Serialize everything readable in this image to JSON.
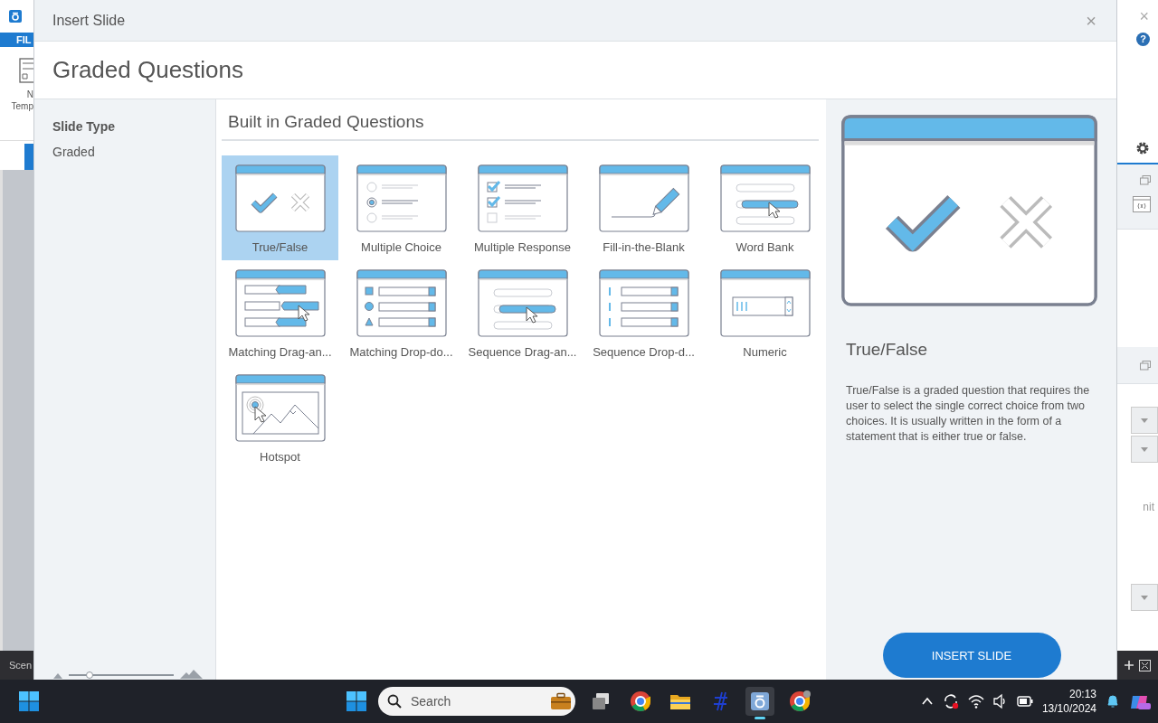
{
  "background_app": {
    "ribbon_tab": "FIL",
    "ribbon_button_lines": [
      "N",
      "Temp"
    ],
    "scenes_label": "Scen",
    "close": "×",
    "help": "?",
    "panel_text": "nit"
  },
  "window": {
    "title": "Insert Slide",
    "close": "×"
  },
  "heading": "Graded Questions",
  "sidebar": {
    "title": "Slide Type",
    "items": [
      {
        "label": "Graded"
      }
    ],
    "zoom_slider": {
      "level": 0.2
    }
  },
  "gallery": {
    "title": "Built in Graded Questions",
    "items": [
      {
        "label": "True/False",
        "kind": "truefalse",
        "selected": true
      },
      {
        "label": "Multiple Choice",
        "kind": "choice",
        "selected": false
      },
      {
        "label": "Multiple Response",
        "kind": "response",
        "selected": false
      },
      {
        "label": "Fill-in-the-Blank",
        "kind": "blank",
        "selected": false
      },
      {
        "label": "Word Bank",
        "kind": "wordbank",
        "selected": false
      },
      {
        "label": "Matching  Drag-an...",
        "kind": "matchdrag",
        "selected": false
      },
      {
        "label": "Matching  Drop-do...",
        "kind": "matchdrop",
        "selected": false
      },
      {
        "label": "Sequence  Drag-an...",
        "kind": "seqdrag",
        "selected": false
      },
      {
        "label": "Sequence  Drop-d...",
        "kind": "seqdrop",
        "selected": false
      },
      {
        "label": "Numeric",
        "kind": "numeric",
        "selected": false
      },
      {
        "label": "Hotspot",
        "kind": "hotspot",
        "selected": false
      }
    ]
  },
  "preview": {
    "kind": "truefalse",
    "title": "True/False",
    "description": "True/False is a graded question that requires the user to select the single correct choice from two choices.  It is usually written in the form of a statement that is either true or false.",
    "button": "INSERT SLIDE"
  },
  "taskbar": {
    "search_placeholder": "Search",
    "time": "20:13",
    "date": "13/10/2024"
  }
}
